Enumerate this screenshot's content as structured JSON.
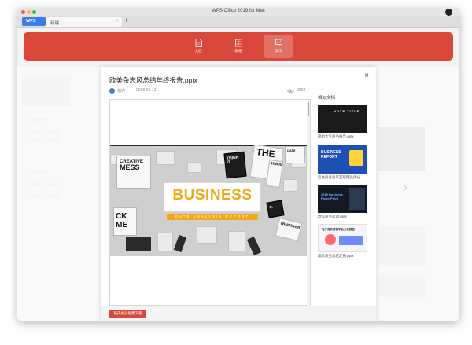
{
  "window": {
    "title": "WPS Office 2019 for Mac"
  },
  "tabs": {
    "app_label": "WPS",
    "document_label": "新建",
    "close_glyph": "×",
    "add_glyph": "+"
  },
  "ribbon": {
    "items": [
      {
        "label": "文档",
        "icon": "document-icon",
        "active": false
      },
      {
        "label": "表格",
        "icon": "spreadsheet-icon",
        "active": false
      },
      {
        "label": "演示",
        "icon": "presentation-icon",
        "active": true
      }
    ],
    "color": "#d9483b"
  },
  "dialog": {
    "title": "欧美杂志风总结年终报告.pptx",
    "close_glyph": "×",
    "author": "稻壳",
    "date": "2018-01-12",
    "views": "2308",
    "download_button": "稻壳会员免费下载",
    "preview": {
      "headline": "BUSINESS",
      "subtitle": "DATE ANALYSIS REPORT",
      "accent_color": "#f2a918",
      "cards": [
        "CREATIVE",
        "MESS",
        "THINK IT",
        "THE",
        "KNOWN",
        "WHATEVER",
        "CK",
        "ME",
        "DATE",
        "DI"
      ]
    }
  },
  "related": {
    "title": "相似文档",
    "items": [
      {
        "caption": "简约大气商务报告.pptx",
        "thumb_text": "NOTE TITLE"
      },
      {
        "caption": "蓝色商务扁平互联网品牌分...",
        "thumb_text": "BUSINESS REPORT"
      },
      {
        "caption": "欧美商务蓝调.pptx",
        "thumb_text": "2019 Business PowerPoint"
      },
      {
        "caption": "炫彩商务总结汇报.pptx",
        "thumb_text": "电子商务营销平台分析报告"
      }
    ]
  },
  "background": {
    "arrow_glyph": "›"
  }
}
